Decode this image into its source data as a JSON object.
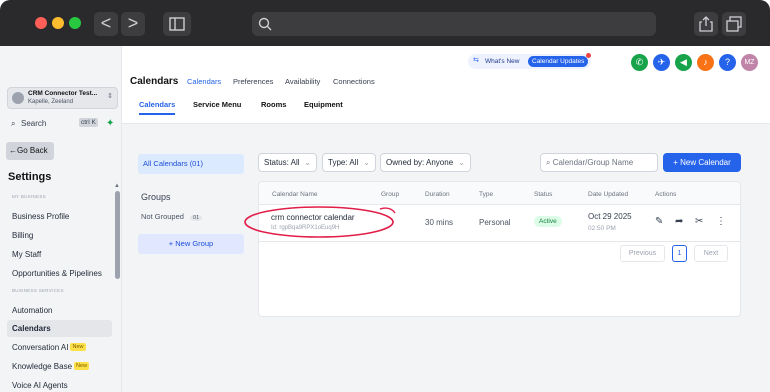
{
  "browser": {
    "back": "<",
    "forward": ">"
  },
  "sidebar": {
    "location_name": "CRM Connector Test...",
    "location_sub": "Kapelle, Zeeland",
    "search_label": "Search",
    "search_kbd": "ctrl K",
    "go_back": "Go Back",
    "settings_title": "Settings",
    "section_my_business": "MY BUSINESS",
    "section_business_services": "BUSINESS SERVICES",
    "items": [
      "Business Profile",
      "Billing",
      "My Staff",
      "Opportunities & Pipelines",
      "Automation",
      "Calendars",
      "Conversation AI",
      "Knowledge Base",
      "Voice AI Agents"
    ],
    "new_badge": "New"
  },
  "header": {
    "title": "Calendars",
    "tabs": [
      "Calendars",
      "Preferences",
      "Availability",
      "Connections"
    ],
    "whats_new": "What's New",
    "calendar_updates": "Calendar Updates",
    "avatar": "MZ"
  },
  "subtabs": [
    "Calendars",
    "Service Menu",
    "Rooms",
    "Equipment"
  ],
  "left_panel": {
    "all_calendars": "All Calendars (01)",
    "groups_title": "Groups",
    "not_grouped": "Not Grouped",
    "not_grouped_count": "01",
    "new_group": "+ New Group"
  },
  "filters": {
    "status": "Status: All",
    "type": "Type: All",
    "owned_by": "Owned by: Anyone",
    "search_placeholder": "Calendar/Group Name",
    "new_calendar": "+ New Calendar"
  },
  "table": {
    "headers": [
      "Calendar Name",
      "Group",
      "Duration",
      "Type",
      "Status",
      "Date Updated",
      "Actions"
    ],
    "rows": [
      {
        "name": "crm connector calendar",
        "id": "Id: rgpBqa9RPX1oEuq9H",
        "duration": "30 mins",
        "type": "Personal",
        "status": "Active",
        "date": "Oct 29 2025",
        "time": "02:50 PM"
      }
    ]
  },
  "pagination": {
    "previous": "Previous",
    "page": "1",
    "next": "Next"
  },
  "colors": {
    "accent": "#2563eb",
    "annotation": "#e11d48"
  }
}
